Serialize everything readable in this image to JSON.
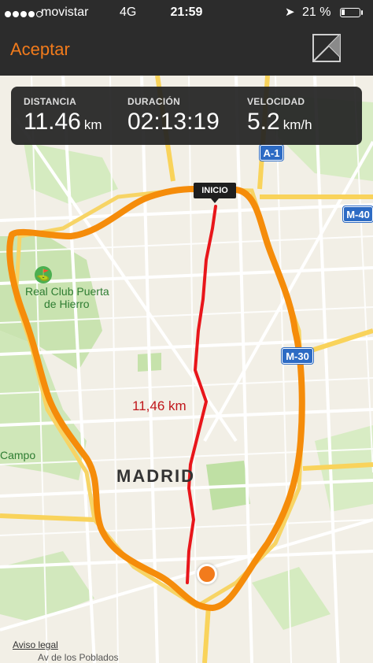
{
  "status_bar": {
    "carrier": "movistar",
    "network": "4G",
    "time": "21:59",
    "battery": "21 %",
    "battery_level": 0.21,
    "signal_bars": 4
  },
  "nav": {
    "accept_label": "Aceptar",
    "share_icon": "share-map-icon"
  },
  "stats": {
    "distance_label": "DISTANCIA",
    "distance_value": "11.46",
    "distance_unit": "km",
    "duration_label": "DURACIÓN",
    "duration_value": "02:13:19",
    "speed_label": "VELOCIDAD",
    "speed_value": "5.2",
    "speed_unit": "km/h"
  },
  "map": {
    "route_start_label": "INICIO",
    "route_distance_label": "11,46 km",
    "city_label": "MADRID",
    "place_labels": {
      "club_line1": "Real Club Puerta",
      "club_line2": "de Hierro",
      "campo": "Campo",
      "aviso_legal": "Aviso legal",
      "poblados": "Av de los Poblados"
    },
    "highway_shields": {
      "a1": "A-1",
      "m40": "M-40",
      "m30": "M-30"
    },
    "colors": {
      "route": "#e8161b",
      "ring_road": "#f58c0a",
      "park": "#c9e3b0",
      "highway_shield": "#2d6bc4",
      "accent": "#f27b1c"
    }
  }
}
